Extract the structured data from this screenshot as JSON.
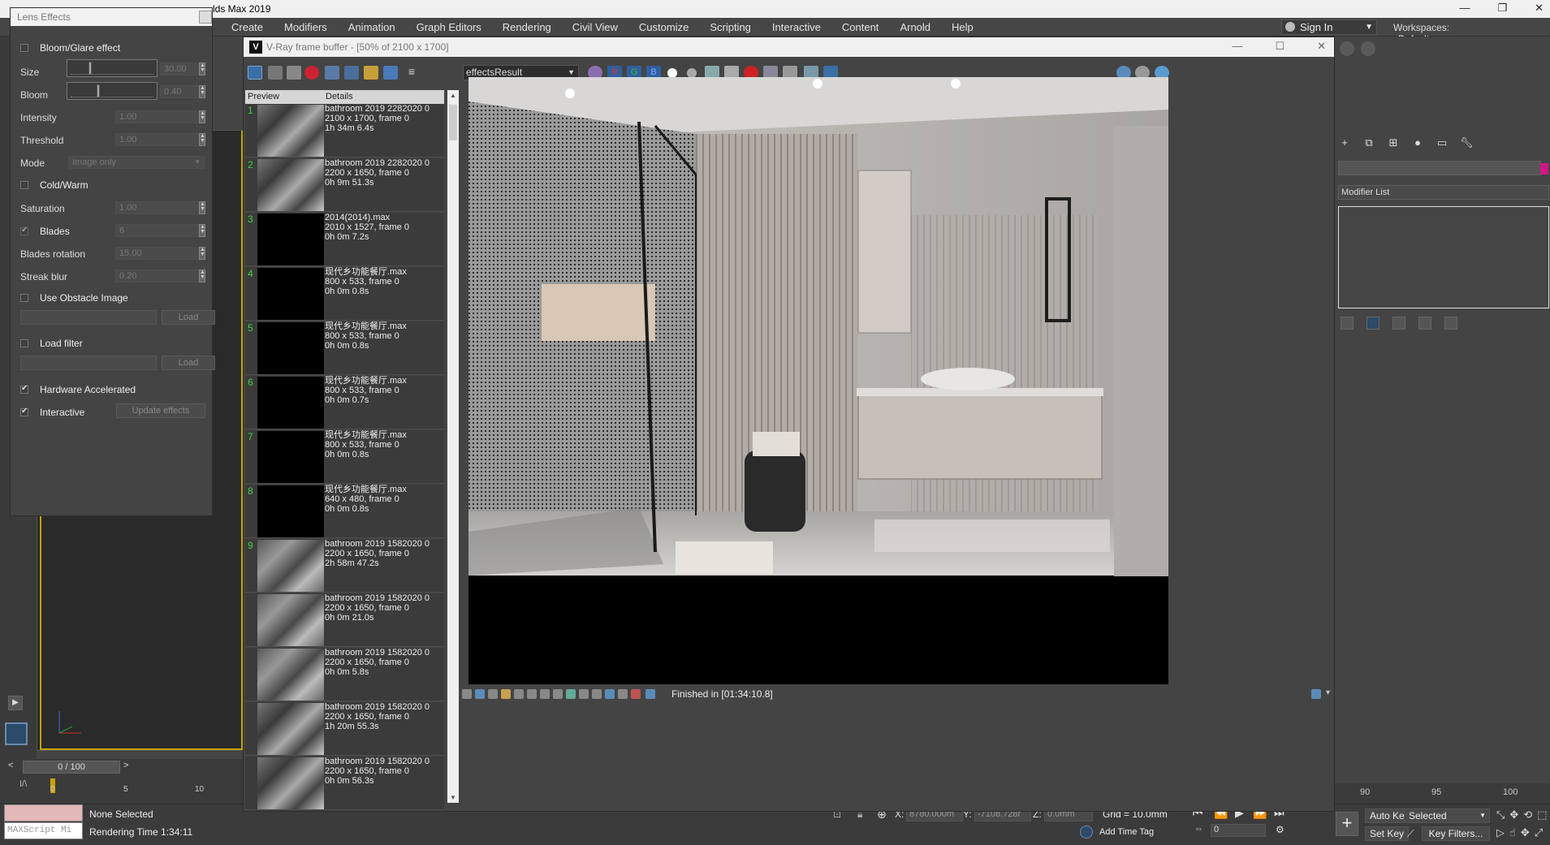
{
  "app": {
    "title": "lds Max 2019",
    "window_controls": [
      "—",
      "❐",
      "✕"
    ]
  },
  "menu": [
    "Create",
    "Modifiers",
    "Animation",
    "Graph Editors",
    "Rendering",
    "Civil View",
    "Customize",
    "Scripting",
    "Interactive",
    "Content",
    "Arnold",
    "Help"
  ],
  "account": {
    "sign_in": "Sign In",
    "workspaces_label": "Workspaces:",
    "workspace": "Default"
  },
  "lens": {
    "title": "Lens Effects",
    "bloom_glare": "Bloom/Glare effect",
    "size_label": "Size",
    "size_value": "30.00",
    "size_fraction": 0.25,
    "bloom_label": "Bloom",
    "bloom_value": "0.40",
    "bloom_fraction": 0.35,
    "intensity_label": "Intensity",
    "intensity_value": "1.00",
    "threshold_label": "Threshold",
    "threshold_value": "1.00",
    "mode_label": "Mode",
    "mode_value": "Image only",
    "cold_warm": "Cold/Warm",
    "saturation_label": "Saturation",
    "saturation_value": "1.00",
    "blades_label": "Blades",
    "blades_value": "6",
    "blades_rotation_label": "Blades rotation",
    "blades_rotation_value": "15.00",
    "streak_blur_label": "Streak blur",
    "streak_blur_value": "0.20",
    "use_obstacle": "Use Obstacle Image",
    "load": "Load",
    "load_filter": "Load filter",
    "hardware_accel": "Hardware Accelerated",
    "interactive": "Interactive",
    "update_effects": "Update effects"
  },
  "vfb": {
    "title": "V-Ray frame buffer - [50% of 2100 x 1700]",
    "channel": "effectsResult",
    "rgb": [
      "R",
      "G",
      "B"
    ],
    "col_preview": "Preview",
    "col_details": "Details",
    "status": "Finished in [01:34:10.8]",
    "history": [
      {
        "n": "1",
        "name": "bathroom 2019 2282020 0",
        "res": "2100 x 1700, frame 0",
        "time": "1h 34m 6.4s",
        "thumb": "lit"
      },
      {
        "n": "2",
        "name": "bathroom 2019 2282020 0",
        "res": "2200 x 1650, frame 0",
        "time": "0h 9m 51.3s",
        "thumb": "lit"
      },
      {
        "n": "3",
        "name": "2014(2014).max",
        "res": "2010 x 1527, frame 0",
        "time": "0h 0m 7.2s",
        "thumb": "black"
      },
      {
        "n": "4",
        "name": "现代乡功能餐厅.max",
        "res": "800 x 533, frame 0",
        "time": "0h 0m 0.8s",
        "thumb": "black"
      },
      {
        "n": "5",
        "name": "现代乡功能餐厅.max",
        "res": "800 x 533, frame 0",
        "time": "0h 0m 0.8s",
        "thumb": "black"
      },
      {
        "n": "6",
        "name": "现代乡功能餐厅.max",
        "res": "800 x 533, frame 0",
        "time": "0h 0m 0.7s",
        "thumb": "black"
      },
      {
        "n": "7",
        "name": "现代乡功能餐厅.max",
        "res": "800 x 533, frame 0",
        "time": "0h 0m 0.8s",
        "thumb": "black"
      },
      {
        "n": "8",
        "name": "现代乡功能餐厅.max",
        "res": "640 x 480, frame 0",
        "time": "0h 0m 0.8s",
        "thumb": "black"
      },
      {
        "n": "9",
        "name": "bathroom 2019 1582020 0",
        "res": "2200 x 1650, frame 0",
        "time": "2h 58m 47.2s",
        "thumb": "ext"
      },
      {
        "n": "",
        "name": "bathroom 2019 1582020 0",
        "res": "2200 x 1650, frame 0",
        "time": "0h 0m 21.0s",
        "thumb": "ext"
      },
      {
        "n": "",
        "name": "bathroom 2019 1582020 0",
        "res": "2200 x 1650, frame 0",
        "time": "0h 0m 5.8s",
        "thumb": "ext"
      },
      {
        "n": "",
        "name": "bathroom 2019 1582020 0",
        "res": "2200 x 1650, frame 0",
        "time": "1h 20m 55.3s",
        "thumb": "lit"
      },
      {
        "n": "",
        "name": "bathroom 2019 1582020 0",
        "res": "2200 x 1650, frame 0",
        "time": "0h 0m 56.3s",
        "thumb": "lit"
      }
    ]
  },
  "cmd": {
    "modifier_list": "Modifier List"
  },
  "timeline": {
    "frame": "0 / 100",
    "ticks": [
      "0",
      "5",
      "10"
    ],
    "rticks": [
      "90",
      "95",
      "100"
    ]
  },
  "status": {
    "selection": "None Selected",
    "render_time": "Rendering Time  1:34:11",
    "maxscript": "MAXScript Mi",
    "x_label": "X:",
    "x": "8780.000m",
    "y_label": "Y:",
    "y": "-7108.728r",
    "z_label": "Z:",
    "z": "0.0mm",
    "grid": "Grid = 10.0mm",
    "add_time_tag": "Add Time Tag",
    "frame_field": "0",
    "auto_key": "Auto Key",
    "selected": "Selected",
    "set_key": "Set Key",
    "key_filters": "Key Filters..."
  }
}
